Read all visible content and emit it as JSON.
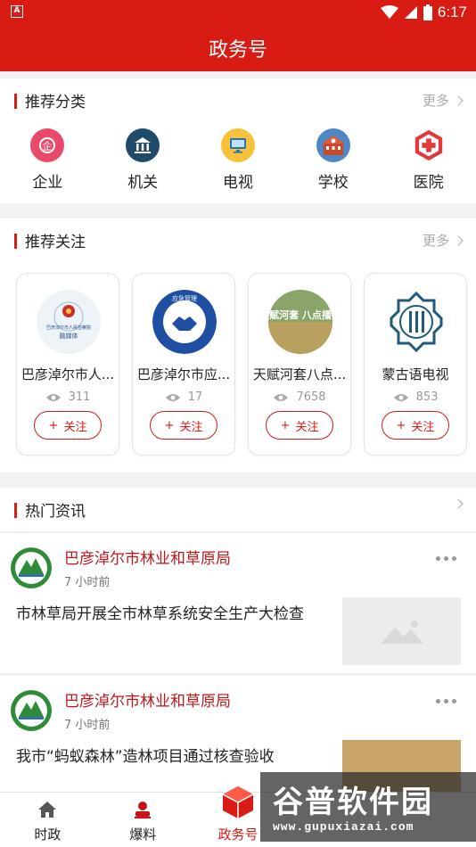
{
  "header": {
    "title": "政务号",
    "status_time": "6:17",
    "app_badge": "A"
  },
  "categories": {
    "section_title": "推荐分类",
    "more_label": "更多",
    "items": [
      {
        "label": "企业",
        "icon": "enterprise-icon",
        "color": "#e94a6a"
      },
      {
        "label": "机关",
        "icon": "government-building-icon",
        "color": "#1f4a6b"
      },
      {
        "label": "电视",
        "icon": "tv-icon",
        "color": "#f5c23a"
      },
      {
        "label": "学校",
        "icon": "school-icon",
        "color": "#4f86c6"
      },
      {
        "label": "医院",
        "icon": "hospital-icon",
        "color": "#e23a3a"
      }
    ]
  },
  "follow": {
    "section_title": "推荐关注",
    "more_label": "更多",
    "cards": [
      {
        "name": "巴彦淖尔市人...",
        "views": "311",
        "button": "关注",
        "logo_text": "巴彦淖尔市人民检察院"
      },
      {
        "name": "巴彦淖尔市应...",
        "views": "17",
        "button": "关注",
        "logo_text": "应急管理"
      },
      {
        "name": "天赋河套八点...",
        "views": "7658",
        "button": "关注",
        "logo_text": "天赋河套 八点播报"
      },
      {
        "name": "蒙古语电视",
        "views": "853",
        "button": "关注"
      }
    ]
  },
  "hot": {
    "section_title": "热门资讯",
    "items": [
      {
        "source": "巴彦淖尔市林业和草原局",
        "time": "7 小时前",
        "headline": "市林草局开展全市林草系统安全生产大检查"
      },
      {
        "source": "巴彦淖尔市林业和草原局",
        "time": "7 小时前",
        "headline": "我市“蚂蚁森林”造林项目通过核查验收"
      }
    ]
  },
  "tabbar": {
    "tabs": [
      {
        "label": "时政",
        "icon": "home-icon"
      },
      {
        "label": "爆料",
        "icon": "reporter-icon"
      },
      {
        "label": "政务号",
        "icon": "gov-cube-icon",
        "active": true
      }
    ]
  },
  "watermark": {
    "title": "谷普软件园",
    "url": "www.gupuxiazai.com"
  }
}
